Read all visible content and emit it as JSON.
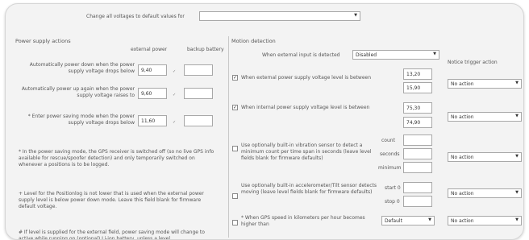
{
  "top": {
    "label": "Change all voltages to default values for",
    "select_value": ""
  },
  "power": {
    "title": "Power supply actions",
    "col_external": "external power",
    "col_battery": "backup battery",
    "rows": [
      {
        "label": "Automatically power down when the power supply voltage drops below",
        "external": "9,40",
        "battery": ""
      },
      {
        "label": "Automatically power up again when the power supply voltage raises to",
        "external": "9,60",
        "battery": ""
      },
      {
        "label": "* Enter power saving mode when the power supply voltage drops below",
        "external": "11,60",
        "battery": ""
      }
    ],
    "notes": [
      "* In the power saving mode, the GPS receiver is switched off (so no live GPS info available for rescue/spoofer detection) and only temporarily switched on whenever a positions is to be logged.",
      "+ Level for the Positionlog is not lower that is used when the external power supply level is below power down mode. Leave this field blank for firmware default voltage.",
      "# If level is supplied for the external field, power saving mode will change to active while running on (optional) Li-ion battery, unless a level"
    ]
  },
  "motion": {
    "title": "Motion detection",
    "mode_label": "When external input is detected",
    "mode_value": "Disabled",
    "notice_header": "Notice trigger action",
    "rules": [
      {
        "checked": true,
        "label": "When external power supply voltage level is between",
        "v1": "13,20",
        "v2": "15,90",
        "action": "No action"
      },
      {
        "checked": true,
        "label": "When internal power supply voltage level is between",
        "v1": "75,30",
        "v2": "74,90",
        "action": "No action"
      },
      {
        "checked": false,
        "label": "Use optionally built-in vibration sensor to detect a minimum count per time span in seconds (leave level fields blank for firmware defaults)",
        "sub": [
          "count",
          "seconds",
          "minimum"
        ],
        "action": "No action"
      },
      {
        "checked": false,
        "label": "Use optionally built-in accelerometer/Tilt sensor detects moving (leave level fields blank for firmware defaults)",
        "sub": [
          "start 0",
          "stop 0"
        ],
        "action": "No action"
      },
      {
        "checked": false,
        "label": "* When GPS speed in kilometers per hour becomes higher than",
        "speed_select": "Default",
        "action": "No action"
      }
    ]
  }
}
